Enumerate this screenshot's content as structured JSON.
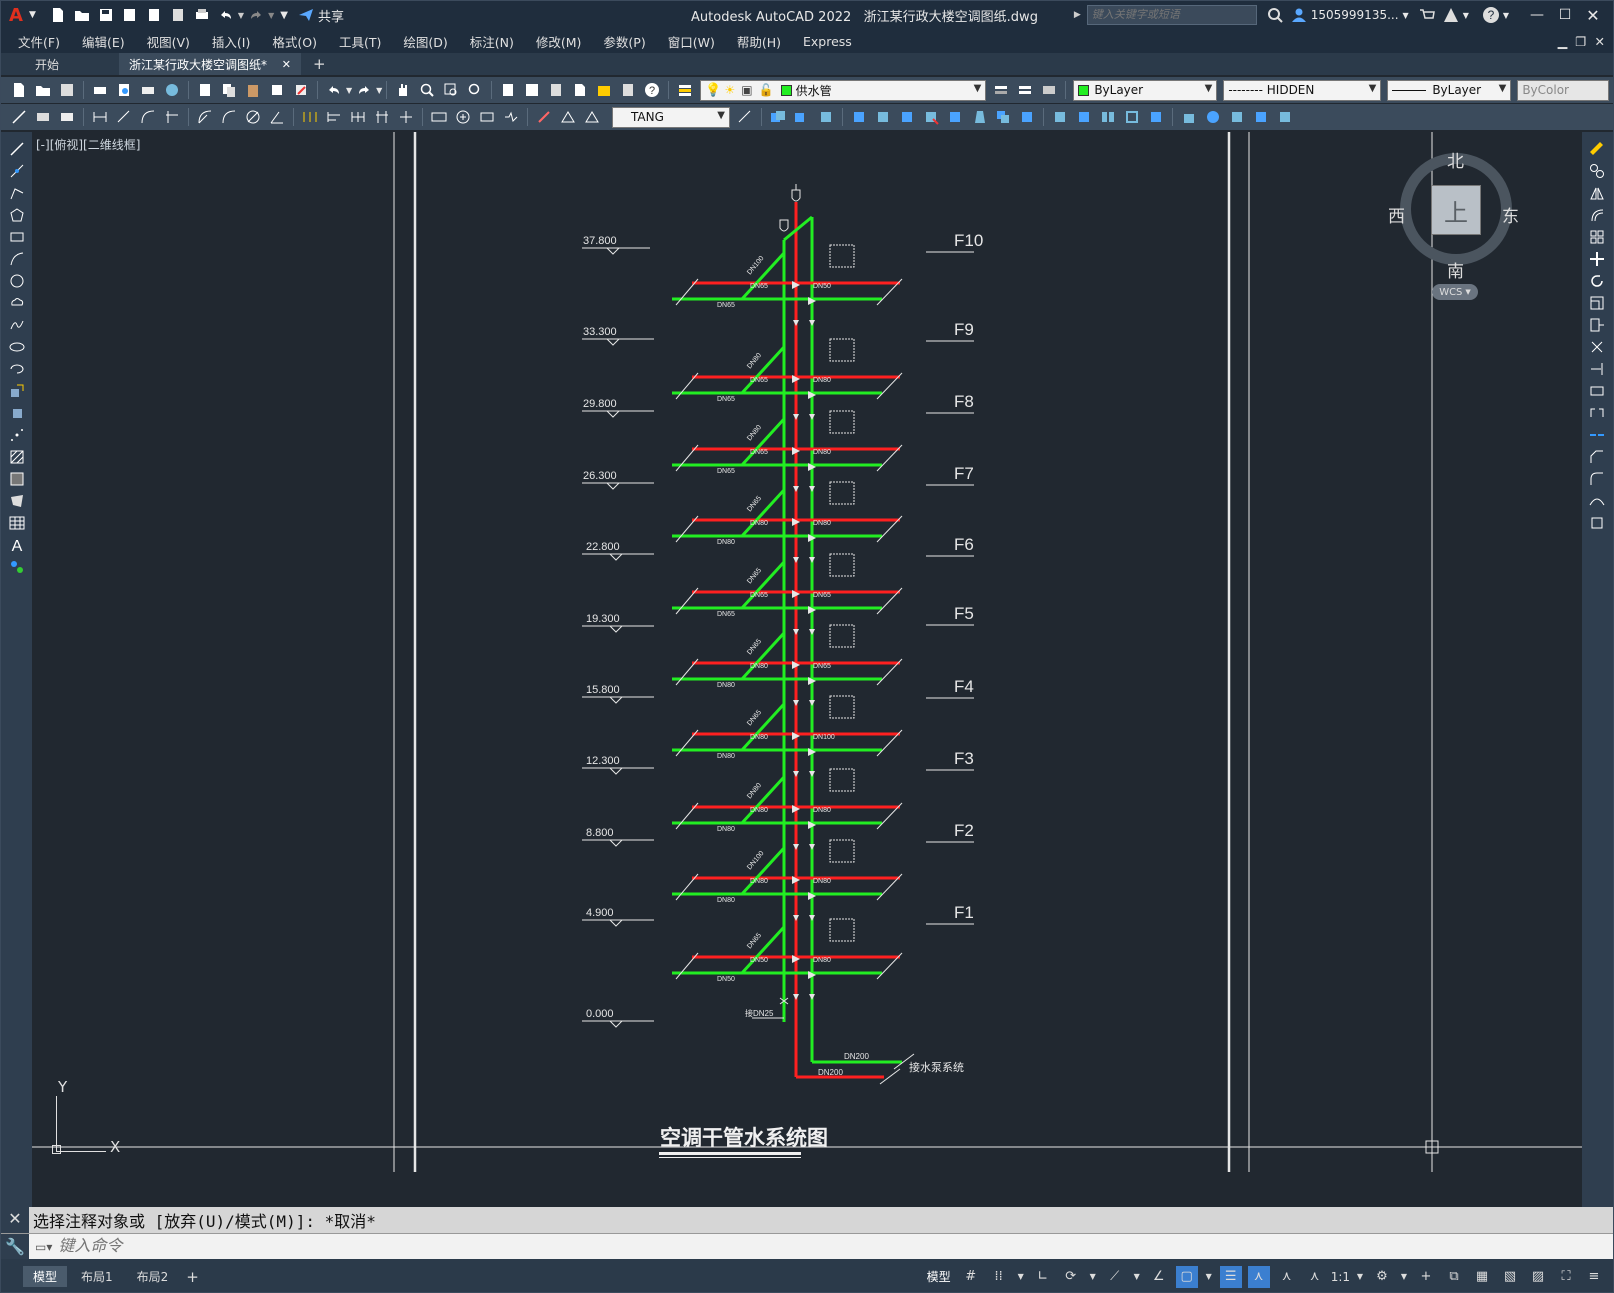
{
  "titlebar": {
    "app_title": "Autodesk AutoCAD 2022",
    "file_title": "浙江某行政大楼空调图纸.dwg",
    "share_label": "共享",
    "search_placeholder": "键入关键字或短语",
    "user_label": "1505999135..."
  },
  "menu": [
    "文件(F)",
    "编辑(E)",
    "视图(V)",
    "插入(I)",
    "格式(O)",
    "工具(T)",
    "绘图(D)",
    "标注(N)",
    "修改(M)",
    "参数(P)",
    "窗口(W)",
    "帮助(H)",
    "Express"
  ],
  "tabs": {
    "start": "开始",
    "drawing": "浙江某行政大楼空调图纸*",
    "new": "+"
  },
  "toolbar": {
    "layer_value": "供水管",
    "color_value": "ByLayer",
    "linetype_value": "-------- HIDDEN",
    "lineweight_value": "ByLayer",
    "plotstyle_value": "ByColor",
    "dimstyle_value": "TANG"
  },
  "viewport": {
    "label": "[-][俯视][二维线框]"
  },
  "viewcube": {
    "north": "北",
    "south": "南",
    "east": "东",
    "west": "西",
    "face": "上",
    "wcs": "WCS"
  },
  "ucs": {
    "x": "X",
    "y": "Y"
  },
  "drawing": {
    "title": "空调干管水系统图",
    "elevations": [
      "37.800",
      "33.300",
      "29.800",
      "26.300",
      "22.800",
      "19.300",
      "15.800",
      "12.300",
      "8.800",
      "4.900",
      "0.000"
    ],
    "floors": [
      "F10",
      "F9",
      "F8",
      "F7",
      "F6",
      "F5",
      "F4",
      "F3",
      "F2",
      "F1"
    ],
    "pipe_sizes": [
      "DN100",
      "DN65",
      "DN50",
      "DN80",
      "DN65",
      "DN80",
      "DN80",
      "DN65",
      "DN80",
      "DN65",
      "DN80",
      "DN80",
      "DN65",
      "DN65",
      "DN65",
      "DN65",
      "DN80",
      "DN65",
      "DN65",
      "DN80",
      "DN100",
      "DN80",
      "DN80",
      "DN80",
      "DN100",
      "DN80",
      "DN80",
      "DN80"
    ],
    "drain_label": "接DN25",
    "main_top": "DN200",
    "main_bottom": "DN200",
    "pump_label": "接水泵系统"
  },
  "command": {
    "history": "选择注释对象或 [放弃(U)/模式(M)]: *取消*",
    "placeholder": "键入命令"
  },
  "status": {
    "layout_tabs": [
      "模型",
      "布局1",
      "布局2"
    ],
    "model_label": "模型",
    "scale": "1:1"
  },
  "colors": {
    "supply": "#ff2020",
    "return": "#22ee22",
    "background": "#212830"
  }
}
